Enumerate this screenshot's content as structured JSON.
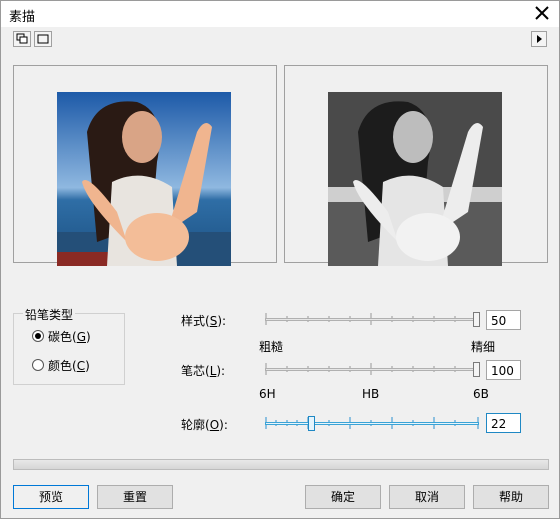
{
  "window": {
    "title": "素描",
    "close_icon": "close-icon"
  },
  "toolbar": {
    "left_icons": [
      "dual-preview-icon",
      "single-preview-icon"
    ],
    "right_icon": "expand-right-icon"
  },
  "pencil_type": {
    "legend": "铅笔类型",
    "options": [
      {
        "label": "碳色(",
        "key": "G",
        "label_end": ")",
        "selected": true
      },
      {
        "label": "颜色(",
        "key": "C",
        "label_end": ")",
        "selected": false
      }
    ]
  },
  "style": {
    "label_pre": "样式(",
    "key": "S",
    "label_post": "):",
    "value": "50",
    "min_label": "粗糙",
    "max_label": "精细",
    "fraction": 1.0
  },
  "lead": {
    "label_pre": "笔芯(",
    "key": "L",
    "label_post": "):",
    "value": "100",
    "tick_labels": [
      "6H",
      "HB",
      "6B"
    ],
    "fraction": 1.0
  },
  "outline": {
    "label_pre": "轮廓(",
    "key": "O",
    "label_post": "):",
    "value": "22",
    "fraction": 0.22
  },
  "buttons": {
    "preview": "预览",
    "reset": "重置",
    "ok": "确定",
    "cancel": "取消",
    "help": "帮助"
  },
  "colors": {
    "accent": "#1f88c4",
    "dialog_bg": "#f0f0f0"
  }
}
